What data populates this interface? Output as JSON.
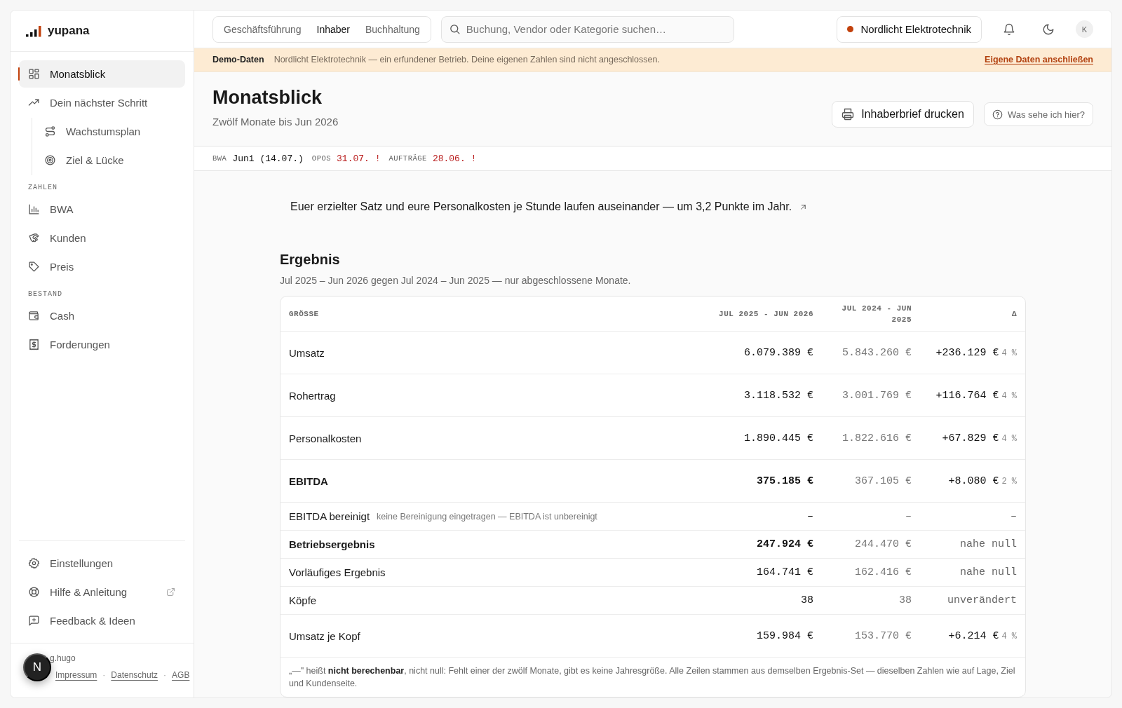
{
  "brand": {
    "name": "yupana"
  },
  "sidebar": {
    "sections": [
      {
        "items": [
          {
            "label": "Monatsblick",
            "selected": true
          },
          {
            "label": "Dein nächster Schritt",
            "selected": false,
            "children": [
              {
                "label": "Wachstumsplan",
                "selected": false
              },
              {
                "label": "Ziel & Lücke",
                "selected": false
              }
            ]
          }
        ]
      },
      {
        "heading": "ZAHLEN",
        "items": [
          {
            "label": "BWA",
            "selected": false
          },
          {
            "label": "Kunden",
            "selected": false
          },
          {
            "label": "Preis",
            "selected": false
          }
        ]
      },
      {
        "heading": "BESTAND",
        "items": [
          {
            "label": "Cash",
            "selected": false
          },
          {
            "label": "Forderungen",
            "selected": false
          }
        ]
      }
    ],
    "bottom_items": [
      {
        "label": "Einstellungen",
        "external": false
      },
      {
        "label": "Hilfe & Anleitung",
        "external": true
      },
      {
        "label": "Feedback & Ideen",
        "external": false
      }
    ],
    "credit": "g.hugo",
    "links": [
      "Impressum",
      "Datenschutz",
      "AGB"
    ],
    "separator": "·",
    "badge": "N"
  },
  "header": {
    "tabs": [
      {
        "label": "Geschäftsführung",
        "selected": false
      },
      {
        "label": "Inhaber",
        "selected": true
      },
      {
        "label": "Buchhaltung",
        "selected": false
      }
    ],
    "search": {
      "placeholder": "Buchung, Vendor oder Kategorie suchen…"
    },
    "company": {
      "label": "Nordlicht Elektrotechnik",
      "color": "#c2410c"
    },
    "avatar": "K"
  },
  "banner": {
    "label": "Demo-Daten",
    "text": "Nordlicht Elektrotechnik — ein erfundener Betrieb. Deine eigenen Zahlen sind nicht angeschlossen.",
    "link": "Eigene Daten anschließen"
  },
  "page": {
    "title": "Monatsblick",
    "subtitle": "Zwölf Monate bis Jun 2026",
    "buttons": [
      {
        "label": "Inhaberbrief drucken",
        "primary": true
      },
      {
        "label": "Was sehe ich hier?",
        "primary": false
      }
    ]
  },
  "status_strip": [
    {
      "label": "BWA",
      "value": "Juni (14.07.)",
      "alert": false
    },
    {
      "label": "OPOS",
      "value": "31.07. !",
      "alert": true
    },
    {
      "label": "AUFTRÄGE",
      "value": "28.06. !",
      "alert": true
    }
  ],
  "insight": {
    "text": "Euer erzielter Satz und eure Personalkosten je Stunde laufen auseinander — um 3,2 Punkte im Jahr."
  },
  "result": {
    "title": "Ergebnis",
    "subtitle": "Jul 2025 – Jun 2026 gegen Jul 2024 – Jun 2025 — nur abgeschlossene Monate.",
    "columns": [
      "GRÖSSE",
      "JUL 2025 - JUN 2026",
      "JUL 2024 - JUN 2025",
      "Δ"
    ],
    "rows": [
      {
        "label": "Umsatz",
        "bold": false,
        "current": "6.079.389 €",
        "previous": "5.843.260 €",
        "delta": "+236.129 €",
        "delta_pct": "4 %"
      },
      {
        "label": "Rohertrag",
        "bold": false,
        "current": "3.118.532 €",
        "previous": "3.001.769 €",
        "delta": "+116.764 €",
        "delta_pct": "4 %"
      },
      {
        "label": "Personalkosten",
        "bold": false,
        "current": "1.890.445 €",
        "previous": "1.822.616 €",
        "delta": "+67.829 €",
        "delta_pct": "4 %"
      },
      {
        "label": "EBITDA",
        "bold": true,
        "current": "375.185 €",
        "previous": "367.105 €",
        "delta": "+8.080 €",
        "delta_pct": "2 %"
      },
      {
        "label": "EBITDA bereinigt",
        "note": "keine Bereinigung eingetragen — EBITDA ist unbereinigt",
        "bold": false,
        "current": "–",
        "previous": "–",
        "delta": "–"
      },
      {
        "label": "Betriebsergebnis",
        "bold": true,
        "current": "247.924 €",
        "previous": "244.470 €",
        "delta": "nahe null"
      },
      {
        "label": "Vorläufiges Ergebnis",
        "bold": false,
        "current": "164.741 €",
        "previous": "162.416 €",
        "delta": "nahe null"
      },
      {
        "label": "Köpfe",
        "bold": false,
        "current": "38",
        "previous": "38",
        "delta": "unverändert"
      },
      {
        "label": "Umsatz je Kopf",
        "bold": false,
        "current": "159.984 €",
        "previous": "153.770 €",
        "delta": "+6.214 €",
        "delta_pct": "4 %"
      }
    ],
    "footnote": "„—\" heißt **nicht berechenbar**, nicht null: Fehlt einer der zwölf Monate, gibt es keine Jahresgröße. Alle Zeilen stammen aus demselben Ergebnis-Set — dieselben Zahlen wie auf Lage, Ziel und Kundenseite."
  }
}
